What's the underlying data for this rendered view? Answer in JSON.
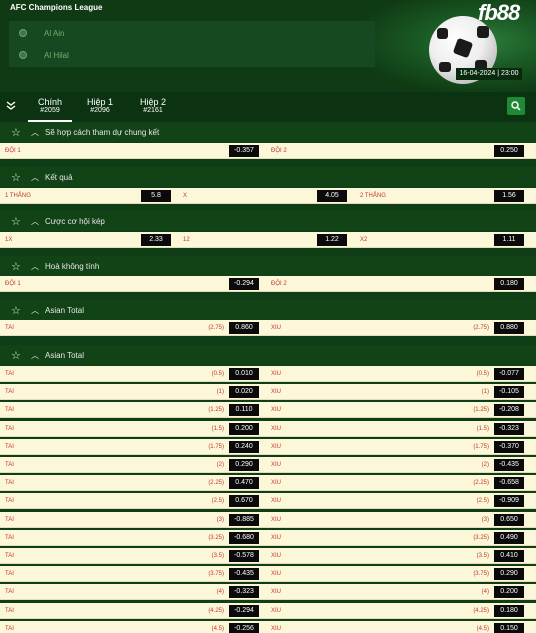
{
  "header": {
    "league": "AFC Champions League",
    "team1": "Al Ain",
    "team2": "Al Hilal",
    "brand": "fb88",
    "datetime": "16-04-2024 | 23:00"
  },
  "tabs": [
    {
      "label": "Chính",
      "code": "#2059"
    },
    {
      "label": "Hiệp 1",
      "code": "#2096"
    },
    {
      "label": "Hiệp 2",
      "code": "#2161"
    }
  ],
  "sections": {
    "s1": {
      "title": "Sẽ hợp cách tham dự chung kết",
      "l": "ĐỘI 1",
      "lo": "-0.357",
      "r": "ĐỘI 2",
      "ro": "0.250"
    },
    "s2": {
      "title": "Kết quả",
      "l": "1 THẮNG",
      "lo": "5.8",
      "m": "X",
      "mo": "4.05",
      "r": "2 THẮNG",
      "ro": "1.56"
    },
    "s3": {
      "title": "Cược cơ hội kép",
      "l": "1X",
      "lo": "2.33",
      "m": "12",
      "mo": "1.22",
      "r": "X2",
      "ro": "1.11"
    },
    "s4": {
      "title": "Hoà không tính",
      "l": "ĐỘI 1",
      "lo": "-0.294",
      "r": "ĐỘI 2",
      "ro": "0.180"
    },
    "s5": {
      "title": "Asian Total",
      "l": "TAI",
      "lh": "(2.75)",
      "lo": "0.860",
      "r": "XIU",
      "rh": "(2.75)",
      "ro": "0.880"
    },
    "s6": {
      "title": "Asian Total"
    }
  },
  "asian_total_rows": [
    {
      "l": "TAI",
      "lh": "(0.5)",
      "lo": "0.010",
      "r": "XIU",
      "rh": "(0.5)",
      "ro": "-0.077"
    },
    {
      "l": "TAI",
      "lh": "(1)",
      "lo": "0.020",
      "r": "XIU",
      "rh": "(1)",
      "ro": "-0.105"
    },
    {
      "l": "TAI",
      "lh": "(1.25)",
      "lo": "0.110",
      "r": "XIU",
      "rh": "(1.25)",
      "ro": "-0.208"
    },
    {
      "l": "TAI",
      "lh": "(1.5)",
      "lo": "0.200",
      "r": "XIU",
      "rh": "(1.5)",
      "ro": "-0.323"
    },
    {
      "l": "TAI",
      "lh": "(1.75)",
      "lo": "0.240",
      "r": "XIU",
      "rh": "(1.75)",
      "ro": "-0.370"
    },
    {
      "l": "TAI",
      "lh": "(2)",
      "lo": "0.290",
      "r": "XIU",
      "rh": "(2)",
      "ro": "-0.435"
    },
    {
      "l": "TAI",
      "lh": "(2.25)",
      "lo": "0.470",
      "r": "XIU",
      "rh": "(2.25)",
      "ro": "-0.658"
    },
    {
      "l": "TAI",
      "lh": "(2.5)",
      "lo": "0.670",
      "r": "XIU",
      "rh": "(2.5)",
      "ro": "-0.909"
    },
    {
      "l": "TAI",
      "lh": "(3)",
      "lo": "-0.885",
      "r": "XIU",
      "rh": "(3)",
      "ro": "0.650"
    },
    {
      "l": "TAI",
      "lh": "(3.25)",
      "lo": "-0.680",
      "r": "XIU",
      "rh": "(3.25)",
      "ro": "0.490"
    },
    {
      "l": "TAI",
      "lh": "(3.5)",
      "lo": "-0.578",
      "r": "XIU",
      "rh": "(3.5)",
      "ro": "0.410"
    },
    {
      "l": "TAI",
      "lh": "(3.75)",
      "lo": "-0.435",
      "r": "XIU",
      "rh": "(3.75)",
      "ro": "0.290"
    },
    {
      "l": "TAI",
      "lh": "(4)",
      "lo": "-0.323",
      "r": "XIU",
      "rh": "(4)",
      "ro": "0.200"
    },
    {
      "l": "TAI",
      "lh": "(4.25)",
      "lo": "-0.294",
      "r": "XIU",
      "rh": "(4.25)",
      "ro": "0.180"
    },
    {
      "l": "TAI",
      "lh": "(4.5)",
      "lo": "-0.256",
      "r": "XIU",
      "rh": "(4.5)",
      "ro": "0.150"
    }
  ],
  "icons": {
    "star": "star-icon",
    "chevron": "chevron-up-icon",
    "search": "search-icon",
    "toggle": "collapse-icon"
  }
}
